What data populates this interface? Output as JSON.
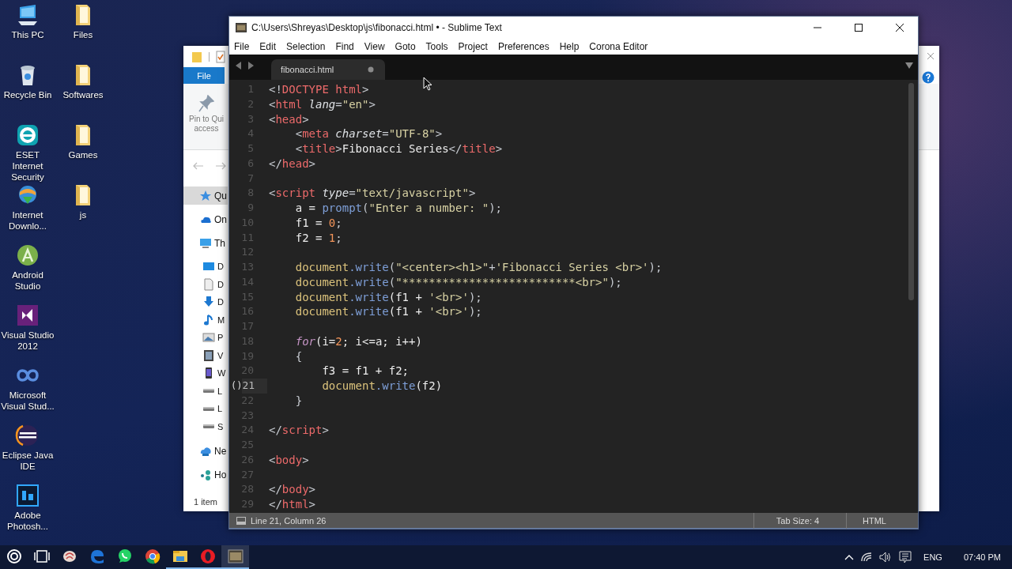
{
  "desktop_icons": [
    {
      "label": "This PC",
      "kind": "pc"
    },
    {
      "label": "Recycle Bin",
      "kind": "recycle"
    },
    {
      "label": "ESET Internet Security",
      "kind": "eset"
    },
    {
      "label": "Internet Downlo...",
      "kind": "idm"
    },
    {
      "label": "Android Studio",
      "kind": "android"
    },
    {
      "label": "Visual Studio 2012",
      "kind": "vs"
    },
    {
      "label": "Microsoft Visual Stud...",
      "kind": "infinity"
    },
    {
      "label": "Eclipse Java IDE",
      "kind": "eclipse"
    },
    {
      "label": "Adobe Photosh...",
      "kind": "ps"
    },
    {
      "label": "Files",
      "kind": "folder"
    },
    {
      "label": "Softwares",
      "kind": "folder"
    },
    {
      "label": "Games",
      "kind": "folder"
    },
    {
      "label": "js",
      "kind": "folder"
    }
  ],
  "explorer": {
    "ribbon_tab": "File",
    "pin_label": "Pin to Qui access",
    "nav_items": [
      {
        "label": "Qu",
        "kind": "star",
        "selected": true
      },
      {
        "label": "On",
        "kind": "cloud",
        "selected": false
      },
      {
        "label": "Th",
        "kind": "pc",
        "selected": false,
        "children": [
          {
            "label": "D",
            "kind": "desktop",
            "selected": false
          },
          {
            "label": "D",
            "kind": "doc",
            "selected": false
          },
          {
            "label": "D",
            "kind": "download",
            "selected": false
          },
          {
            "label": "M",
            "kind": "music",
            "selected": false
          },
          {
            "label": "P",
            "kind": "picture",
            "selected": false
          },
          {
            "label": "V",
            "kind": "video",
            "selected": false
          },
          {
            "label": "W",
            "kind": "phone",
            "selected": false
          },
          {
            "label": "L",
            "kind": "drive",
            "selected": false
          },
          {
            "label": "L",
            "kind": "drive",
            "selected": false
          },
          {
            "label": "S",
            "kind": "drive",
            "selected": false
          }
        ]
      },
      {
        "label": "Ne",
        "kind": "network",
        "selected": false
      },
      {
        "label": "Ho",
        "kind": "homegroup",
        "selected": false
      }
    ],
    "status": "1 item"
  },
  "editor": {
    "title": "C:\\Users\\Shreyas\\Desktop\\js\\fibonacci.html • - Sublime Text",
    "menu": [
      "File",
      "Edit",
      "Selection",
      "Find",
      "View",
      "Goto",
      "Tools",
      "Project",
      "Preferences",
      "Help",
      "Corona Editor"
    ],
    "tabs": [
      {
        "label": "fibonacci.html",
        "selected": true,
        "modified": true
      }
    ],
    "lines": [
      {
        "number": "1",
        "current": false,
        "tokens": [
          {
            "kind": "punct",
            "text": "<!"
          },
          {
            "kind": "tag",
            "text": "DOCTYPE html"
          },
          {
            "kind": "punct",
            "text": ">"
          }
        ]
      },
      {
        "number": "2",
        "current": false,
        "tokens": [
          {
            "kind": "punct",
            "text": "<"
          },
          {
            "kind": "tag",
            "text": "html"
          },
          {
            "kind": "attr",
            "text": " lang"
          },
          {
            "kind": "punct",
            "text": "="
          },
          {
            "kind": "string",
            "text": "\"en\""
          },
          {
            "kind": "punct",
            "text": ">"
          }
        ]
      },
      {
        "number": "3",
        "current": false,
        "tokens": [
          {
            "kind": "punct",
            "text": "<"
          },
          {
            "kind": "tag",
            "text": "head"
          },
          {
            "kind": "punct",
            "text": ">"
          }
        ]
      },
      {
        "number": "4",
        "current": false,
        "tokens": [
          {
            "kind": "punct",
            "text": "    <"
          },
          {
            "kind": "tag",
            "text": "meta"
          },
          {
            "kind": "attr",
            "text": " charset"
          },
          {
            "kind": "punct",
            "text": "="
          },
          {
            "kind": "string",
            "text": "\"UTF-8\""
          },
          {
            "kind": "punct",
            "text": ">"
          }
        ]
      },
      {
        "number": "5",
        "current": false,
        "tokens": [
          {
            "kind": "punct",
            "text": "    <"
          },
          {
            "kind": "tag",
            "text": "title"
          },
          {
            "kind": "punct",
            "text": ">"
          },
          {
            "kind": "plain",
            "text": "Fibonacci Series"
          },
          {
            "kind": "punct",
            "text": "</"
          },
          {
            "kind": "tag",
            "text": "title"
          },
          {
            "kind": "punct",
            "text": ">"
          }
        ]
      },
      {
        "number": "6",
        "current": false,
        "tokens": [
          {
            "kind": "punct",
            "text": "</"
          },
          {
            "kind": "tag",
            "text": "head"
          },
          {
            "kind": "punct",
            "text": ">"
          }
        ]
      },
      {
        "number": "7",
        "current": false
      },
      {
        "number": "8",
        "current": false,
        "tokens": [
          {
            "kind": "punct",
            "text": "<"
          },
          {
            "kind": "tag",
            "text": "script"
          },
          {
            "kind": "attr",
            "text": " type"
          },
          {
            "kind": "punct",
            "text": "="
          },
          {
            "kind": "string",
            "text": "\"text/javascript\""
          },
          {
            "kind": "punct",
            "text": ">"
          }
        ]
      },
      {
        "number": "9",
        "current": false,
        "tokens": [
          {
            "kind": "plain",
            "text": "    a = "
          },
          {
            "kind": "function",
            "text": "prompt"
          },
          {
            "kind": "punct",
            "text": "("
          },
          {
            "kind": "string",
            "text": "\"Enter a number: \""
          },
          {
            "kind": "punct",
            "text": ");"
          }
        ]
      },
      {
        "number": "10",
        "current": false,
        "tokens": [
          {
            "kind": "plain",
            "text": "    f1 = "
          },
          {
            "kind": "number",
            "text": "0"
          },
          {
            "kind": "punct",
            "text": ";"
          }
        ]
      },
      {
        "number": "11",
        "current": false,
        "tokens": [
          {
            "kind": "plain",
            "text": "    f2 = "
          },
          {
            "kind": "number",
            "text": "1"
          },
          {
            "kind": "punct",
            "text": ";"
          }
        ]
      },
      {
        "number": "12",
        "current": false
      },
      {
        "number": "13",
        "current": false,
        "tokens": [
          {
            "kind": "object",
            "text": "    document"
          },
          {
            "kind": "function",
            "text": ".write"
          },
          {
            "kind": "punct",
            "text": "("
          },
          {
            "kind": "string",
            "text": "\"<center><h1>\""
          },
          {
            "kind": "punct",
            "text": "+"
          },
          {
            "kind": "string",
            "text": "'Fibonacci Series <br>'"
          },
          {
            "kind": "punct",
            "text": ");"
          }
        ]
      },
      {
        "number": "14",
        "current": false,
        "tokens": [
          {
            "kind": "object",
            "text": "    document"
          },
          {
            "kind": "function",
            "text": ".write"
          },
          {
            "kind": "punct",
            "text": "("
          },
          {
            "kind": "string",
            "text": "\"**************************<br>\""
          },
          {
            "kind": "punct",
            "text": ");"
          }
        ]
      },
      {
        "number": "15",
        "current": false,
        "tokens": [
          {
            "kind": "object",
            "text": "    document"
          },
          {
            "kind": "function",
            "text": ".write"
          },
          {
            "kind": "plain",
            "text": "(f1 + "
          },
          {
            "kind": "string",
            "text": "'<br>'"
          },
          {
            "kind": "punct",
            "text": ");"
          }
        ]
      },
      {
        "number": "16",
        "current": false,
        "tokens": [
          {
            "kind": "object",
            "text": "    document"
          },
          {
            "kind": "function",
            "text": ".write"
          },
          {
            "kind": "plain",
            "text": "(f1 + "
          },
          {
            "kind": "string",
            "text": "'<br>'"
          },
          {
            "kind": "punct",
            "text": ");"
          }
        ]
      },
      {
        "number": "17",
        "current": false
      },
      {
        "number": "18",
        "current": false,
        "tokens": [
          {
            "kind": "keyword",
            "text": "    for"
          },
          {
            "kind": "plain",
            "text": "(i="
          },
          {
            "kind": "number",
            "text": "2"
          },
          {
            "kind": "plain",
            "text": "; i<=a; i++)"
          }
        ]
      },
      {
        "number": "19",
        "current": false,
        "tokens": [
          {
            "kind": "punct",
            "text": "    {"
          }
        ]
      },
      {
        "number": "20",
        "current": false,
        "tokens": [
          {
            "kind": "plain",
            "text": "        f3 = f1 + f2;"
          }
        ]
      },
      {
        "number": "21",
        "current": true,
        "gutter_mark": "()",
        "tokens": [
          {
            "kind": "object",
            "text": "        document"
          },
          {
            "kind": "function",
            "text": ".write"
          },
          {
            "kind": "plain",
            "text": "(f2)"
          }
        ]
      },
      {
        "number": "22",
        "current": false,
        "tokens": [
          {
            "kind": "punct",
            "text": "    }"
          }
        ]
      },
      {
        "number": "23",
        "current": false
      },
      {
        "number": "24",
        "current": false,
        "tokens": [
          {
            "kind": "punct",
            "text": "</"
          },
          {
            "kind": "tag",
            "text": "script"
          },
          {
            "kind": "punct",
            "text": ">"
          }
        ]
      },
      {
        "number": "25",
        "current": false
      },
      {
        "number": "26",
        "current": false,
        "tokens": [
          {
            "kind": "punct",
            "text": "<"
          },
          {
            "kind": "tag",
            "text": "body"
          },
          {
            "kind": "punct",
            "text": ">"
          }
        ]
      },
      {
        "number": "27",
        "current": false
      },
      {
        "number": "28",
        "current": false,
        "tokens": [
          {
            "kind": "punct",
            "text": "</"
          },
          {
            "kind": "tag",
            "text": "body"
          },
          {
            "kind": "punct",
            "text": ">"
          }
        ]
      },
      {
        "number": "29",
        "current": false,
        "tokens": [
          {
            "kind": "punct",
            "text": "</"
          },
          {
            "kind": "tag",
            "text": "html"
          },
          {
            "kind": "punct",
            "text": ">"
          }
        ]
      }
    ],
    "status": {
      "position": "Line 21, Column 26",
      "tab_size": "Tab Size: 4",
      "syntax": "HTML"
    }
  },
  "taskbar": {
    "apps": [
      {
        "kind": "cortana",
        "running": false,
        "selected": false
      },
      {
        "kind": "taskview",
        "running": false,
        "selected": false
      },
      {
        "kind": "brain",
        "running": false,
        "selected": false
      },
      {
        "kind": "edge",
        "running": false,
        "selected": false
      },
      {
        "kind": "whatsapp",
        "running": false,
        "selected": false
      },
      {
        "kind": "chrome",
        "running": false,
        "selected": false
      },
      {
        "kind": "explorer",
        "running": true,
        "selected": false
      },
      {
        "kind": "opera",
        "running": true,
        "selected": false
      },
      {
        "kind": "sublime",
        "running": true,
        "selected": true
      }
    ],
    "language": "ENG",
    "time": "07:40 PM"
  }
}
